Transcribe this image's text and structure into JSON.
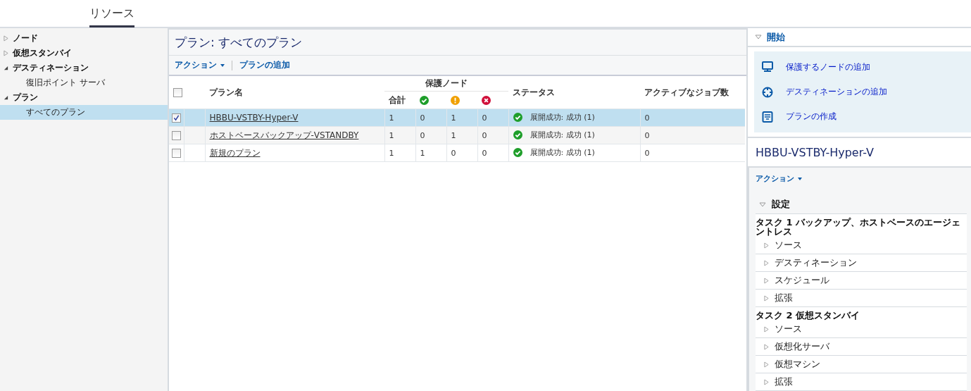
{
  "tabs": [
    {
      "label": "リソース",
      "selected": true
    }
  ],
  "tree": [
    {
      "label": "ノード",
      "expanded": false,
      "selected": false
    },
    {
      "label": "仮想スタンバイ",
      "expanded": false,
      "selected": false
    },
    {
      "label": "デスティネーション",
      "expanded": true,
      "selected": false,
      "children": [
        {
          "label": "復旧ポイント サーバ",
          "selected": false
        }
      ]
    },
    {
      "label": "プラン",
      "expanded": true,
      "selected": false,
      "children": [
        {
          "label": "すべてのプラン",
          "selected": true
        }
      ]
    }
  ],
  "center": {
    "title": "プラン: すべてのプラン",
    "toolbar": [
      {
        "label": "アクション",
        "kind": "dropdown"
      },
      {
        "label": "プランの追加",
        "kind": "link"
      }
    ],
    "table": {
      "select_all_checked": false,
      "columns": {
        "name": "プラン名",
        "group": "保護ノード",
        "total": "合計",
        "status": "ステータス",
        "jobs": "アクティブなジョブ数"
      },
      "status_columns": [
        {
          "kind": "ok"
        },
        {
          "kind": "warning"
        },
        {
          "kind": "error"
        }
      ],
      "rows": [
        {
          "checked": true,
          "selected": true,
          "name": "HBBU-VSTBY-Hyper-V",
          "total": "1",
          "ok": "0",
          "warning": "1",
          "error": "0",
          "status": {
            "kind": "ok",
            "text": "展開成功: 成功 (1)"
          },
          "jobs": "0"
        },
        {
          "checked": false,
          "selected": false,
          "name": "ホストベースバックアップ-VSTANDBY",
          "total": "1",
          "ok": "0",
          "warning": "1",
          "error": "0",
          "status": {
            "kind": "ok",
            "text": "展開成功: 成功 (1)"
          },
          "jobs": "0"
        },
        {
          "checked": false,
          "selected": false,
          "name": "新規のプラン",
          "total": "1",
          "ok": "1",
          "warning": "0",
          "error": "0",
          "status": {
            "kind": "ok",
            "text": "展開成功: 成功 (1)"
          },
          "jobs": "0"
        }
      ]
    }
  },
  "right": {
    "start": {
      "title": "開始",
      "expanded": true,
      "actions": [
        {
          "kind": "monitor",
          "label": "保護するノードの追加"
        },
        {
          "kind": "target",
          "label": "デスティネーションの追加"
        },
        {
          "kind": "document",
          "label": "プランの作成"
        }
      ]
    },
    "detail_title": "HBBU-VSTBY-Hyper-V",
    "action_menu": "アクション",
    "settings": {
      "title": "設定",
      "expanded": true,
      "tasks": [
        {
          "title": "タスク 1 バックアップ、ホストベースのエージェントレス",
          "items": [
            {
              "label": "ソース",
              "expanded": false
            },
            {
              "label": "デスティネーション",
              "expanded": false
            },
            {
              "label": "スケジュール",
              "expanded": false
            },
            {
              "label": "拡張",
              "expanded": false
            }
          ]
        },
        {
          "title": "タスク 2 仮想スタンバイ",
          "items": [
            {
              "label": "ソース",
              "expanded": false
            },
            {
              "label": "仮想化サーバ",
              "expanded": false
            },
            {
              "label": "仮想マシン",
              "expanded": false
            },
            {
              "label": "拡張",
              "expanded": false
            }
          ]
        }
      ]
    }
  }
}
